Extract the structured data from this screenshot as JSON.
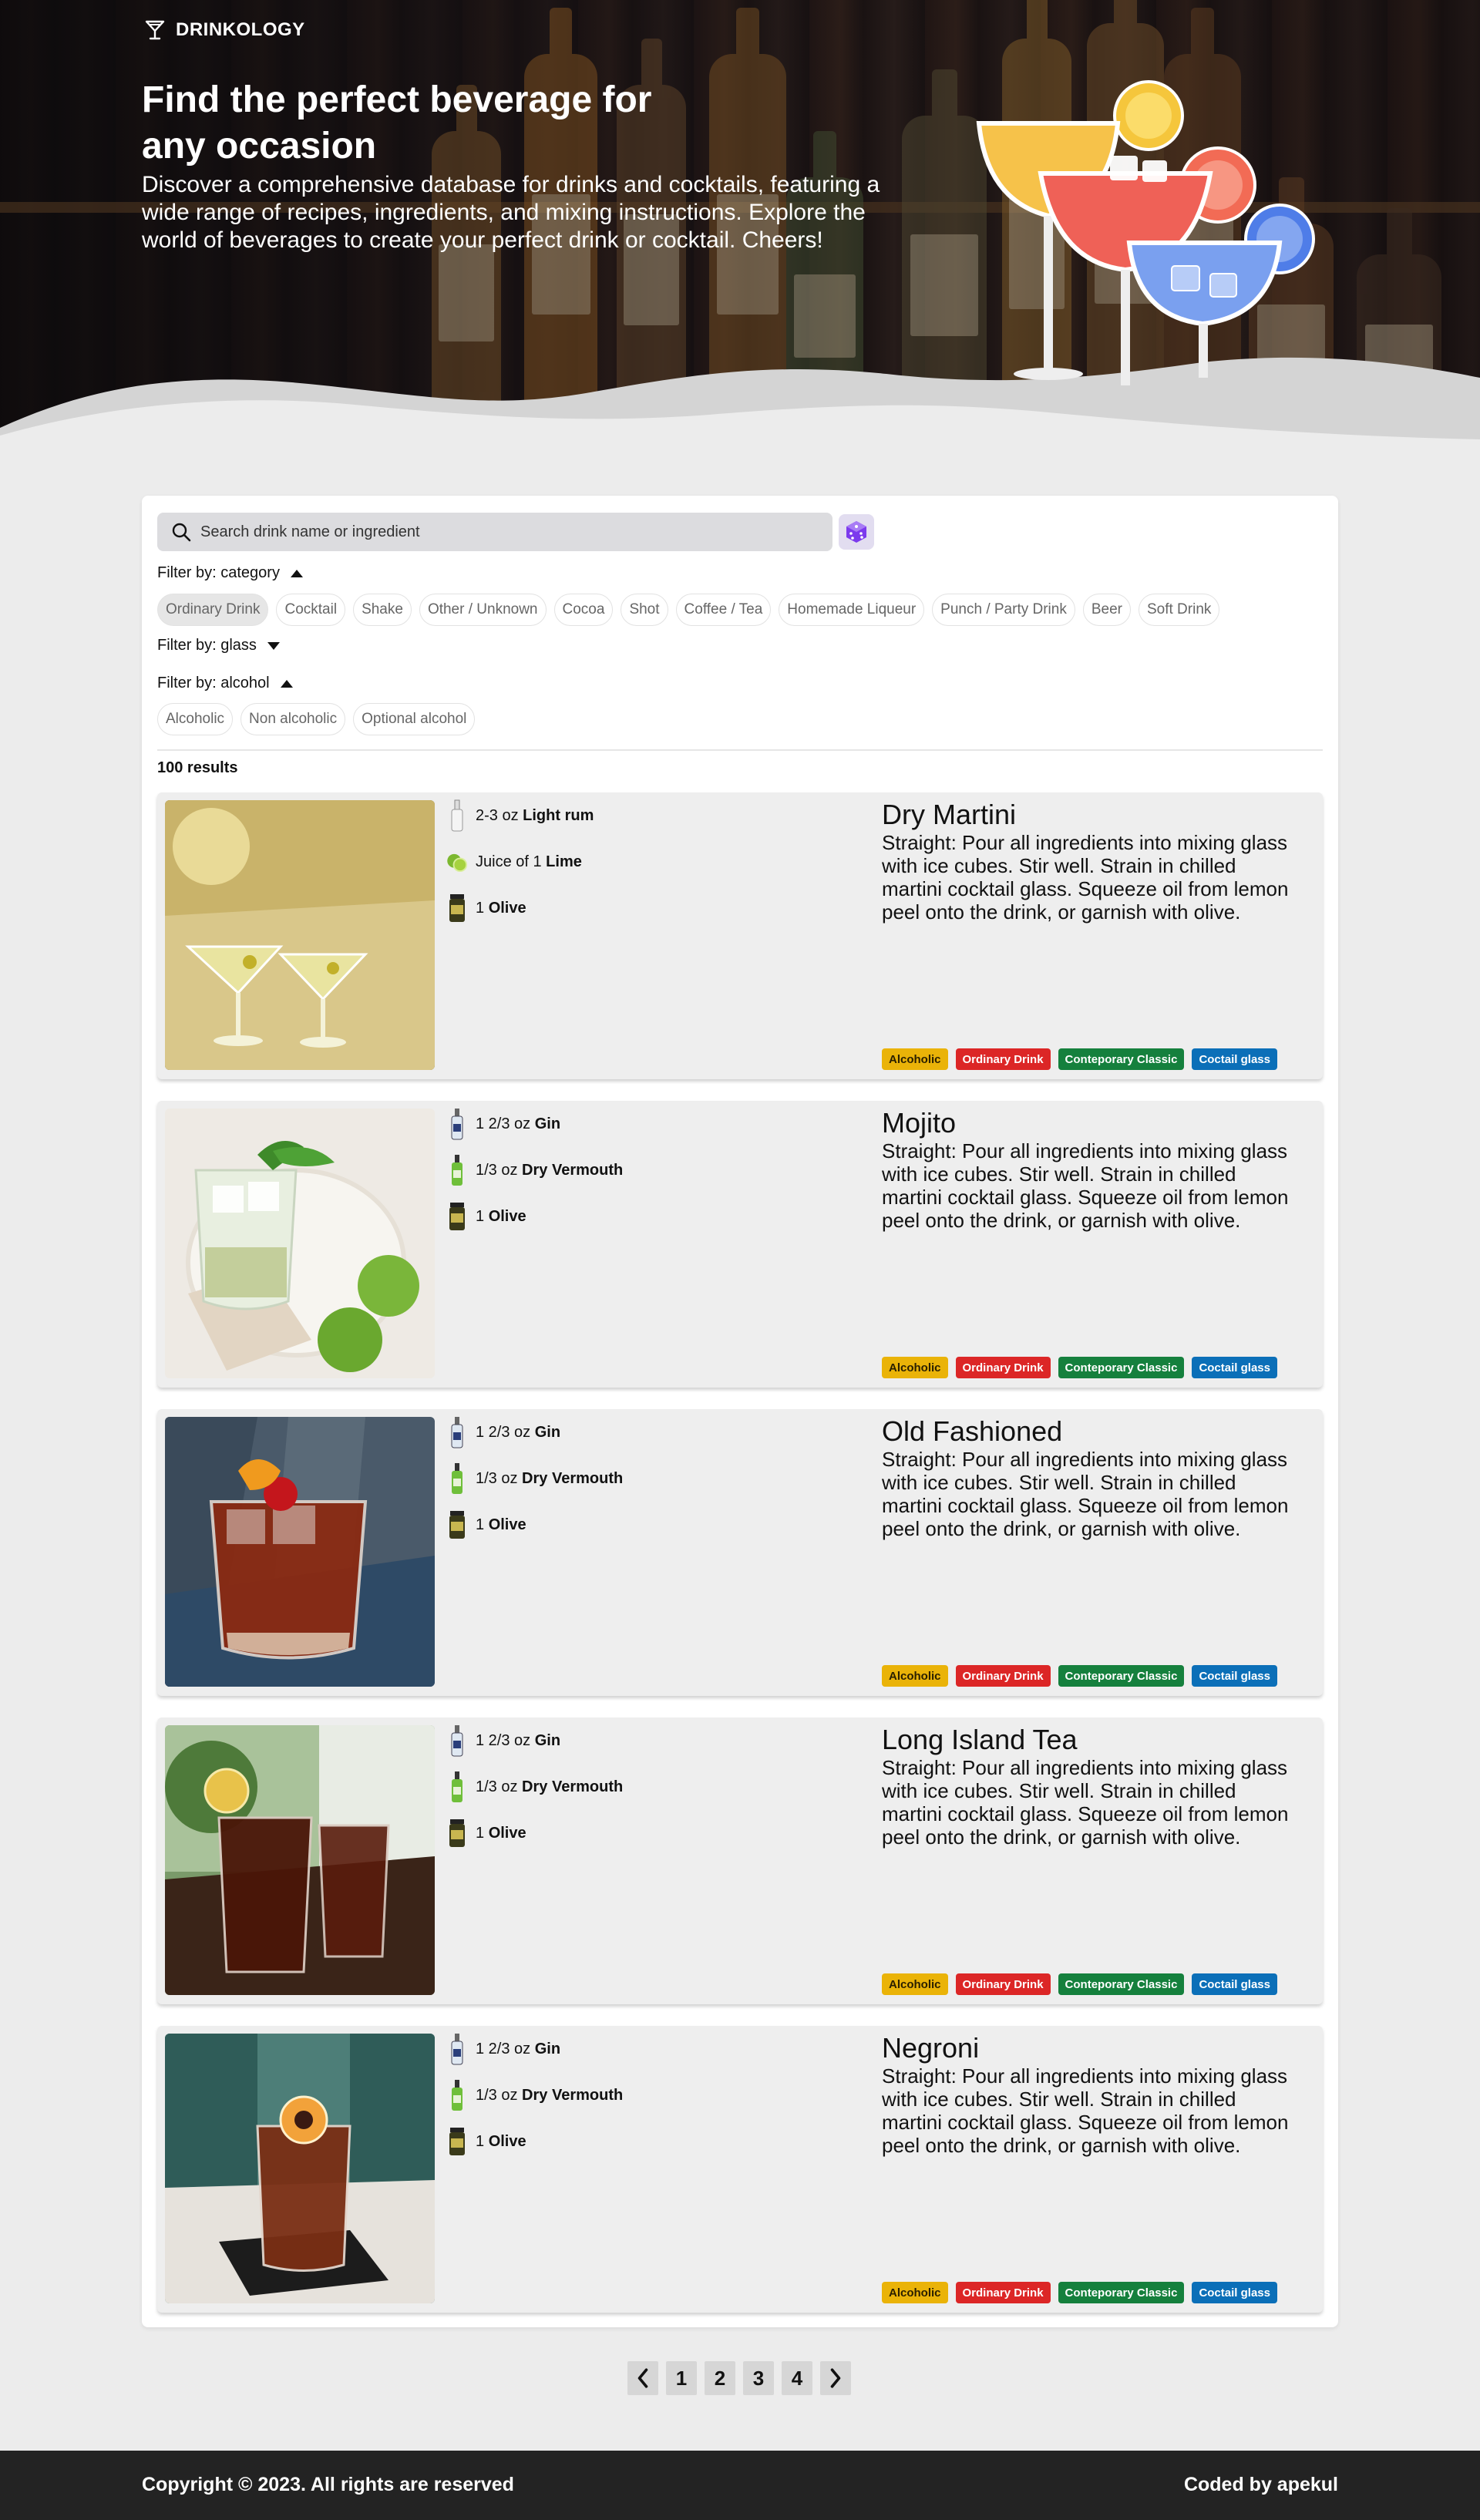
{
  "brand": {
    "name": "DRINKOLOGY",
    "icon": "cocktail-glass-icon"
  },
  "hero": {
    "title": "Find the perfect beverage for any occasion",
    "subtitle": "Discover a comprehensive database for drinks and cocktails, featuring a wide range of recipes, ingredients, and mixing instructions. Explore the world of beverages to create your perfect drink or cocktail. Cheers!"
  },
  "search": {
    "placeholder": "Search drink name or ingredient",
    "value": "",
    "random_icon": "dice-icon"
  },
  "filters": {
    "category": {
      "label": "Filter by: category",
      "expanded": true,
      "options": [
        "Ordinary Drink",
        "Cocktail",
        "Shake",
        "Other / Unknown",
        "Cocoa",
        "Shot",
        "Coffee / Tea",
        "Homemade Liqueur",
        "Punch / Party Drink",
        "Beer",
        "Soft Drink"
      ],
      "selected": "Ordinary Drink"
    },
    "glass": {
      "label": "Filter by: glass",
      "expanded": false
    },
    "alcohol": {
      "label": "Filter by: alcohol",
      "expanded": true,
      "options": [
        "Alcoholic",
        "Non alcoholic",
        "Optional alcohol"
      ]
    }
  },
  "results_label": "100 results",
  "drinks": [
    {
      "name": "Dry Martini",
      "instructions": "Straight: Pour all ingredients into mixing glass with ice cubes. Stir well. Strain in chilled martini cocktail glass. Squeeze oil from lemon peel onto the drink, or garnish with olive.",
      "ingredients": [
        {
          "amount": "2-3 oz ",
          "item": "Light rum",
          "icon": "rum-bottle-icon"
        },
        {
          "amount": "Juice of 1 ",
          "item": "Lime",
          "icon": "lime-icon"
        },
        {
          "amount": "1 ",
          "item": "Olive",
          "icon": "olive-jar-icon"
        }
      ],
      "tags": [
        "Alcoholic",
        "Ordinary Drink",
        "Conteporary Classic",
        "Coctail glass"
      ]
    },
    {
      "name": "Mojito",
      "instructions": "Straight: Pour all ingredients into mixing glass with ice cubes. Stir well. Strain in chilled martini cocktail glass. Squeeze oil from lemon peel onto the drink, or garnish with olive.",
      "ingredients": [
        {
          "amount": "1 2/3 oz ",
          "item": "Gin",
          "icon": "gin-bottle-icon"
        },
        {
          "amount": "1/3 oz ",
          "item": "Dry Vermouth",
          "icon": "vermouth-bottle-icon"
        },
        {
          "amount": "1 ",
          "item": "Olive",
          "icon": "olive-jar-icon"
        }
      ],
      "tags": [
        "Alcoholic",
        "Ordinary Drink",
        "Conteporary Classic",
        "Coctail glass"
      ]
    },
    {
      "name": "Old Fashioned",
      "instructions": "Straight: Pour all ingredients into mixing glass with ice cubes. Stir well. Strain in chilled martini cocktail glass. Squeeze oil from lemon peel onto the drink, or garnish with olive.",
      "ingredients": [
        {
          "amount": "1 2/3 oz ",
          "item": "Gin",
          "icon": "gin-bottle-icon"
        },
        {
          "amount": "1/3 oz ",
          "item": "Dry Vermouth",
          "icon": "vermouth-bottle-icon"
        },
        {
          "amount": "1 ",
          "item": "Olive",
          "icon": "olive-jar-icon"
        }
      ],
      "tags": [
        "Alcoholic",
        "Ordinary Drink",
        "Conteporary Classic",
        "Coctail glass"
      ]
    },
    {
      "name": "Long Island Tea",
      "instructions": "Straight: Pour all ingredients into mixing glass with ice cubes. Stir well. Strain in chilled martini cocktail glass. Squeeze oil from lemon peel onto the drink, or garnish with olive.",
      "ingredients": [
        {
          "amount": "1 2/3 oz ",
          "item": "Gin",
          "icon": "gin-bottle-icon"
        },
        {
          "amount": "1/3 oz ",
          "item": "Dry Vermouth",
          "icon": "vermouth-bottle-icon"
        },
        {
          "amount": "1 ",
          "item": "Olive",
          "icon": "olive-jar-icon"
        }
      ],
      "tags": [
        "Alcoholic",
        "Ordinary Drink",
        "Conteporary Classic",
        "Coctail glass"
      ]
    },
    {
      "name": "Negroni",
      "instructions": "Straight: Pour all ingredients into mixing glass with ice cubes. Stir well. Strain in chilled martini cocktail glass. Squeeze oil from lemon peel onto the drink, or garnish with olive.",
      "ingredients": [
        {
          "amount": "1 2/3 oz ",
          "item": "Gin",
          "icon": "gin-bottle-icon"
        },
        {
          "amount": "1/3 oz ",
          "item": "Dry Vermouth",
          "icon": "vermouth-bottle-icon"
        },
        {
          "amount": "1 ",
          "item": "Olive",
          "icon": "olive-jar-icon"
        }
      ],
      "tags": [
        "Alcoholic",
        "Ordinary Drink",
        "Conteporary Classic",
        "Coctail glass"
      ]
    }
  ],
  "tag_colors": {
    "Alcoholic": "#eab308",
    "Ordinary Drink": "#dc2626",
    "Conteporary Classic": "#15803d",
    "Coctail glass": "#0b6fb8"
  },
  "pagination": {
    "prev_icon": "chevron-left-icon",
    "pages": [
      "1",
      "2",
      "3",
      "4"
    ],
    "next_icon": "chevron-right-icon"
  },
  "footer": {
    "copyright": "Copyright © 2023. All rights are reserved",
    "credit": "Coded by apekul"
  }
}
